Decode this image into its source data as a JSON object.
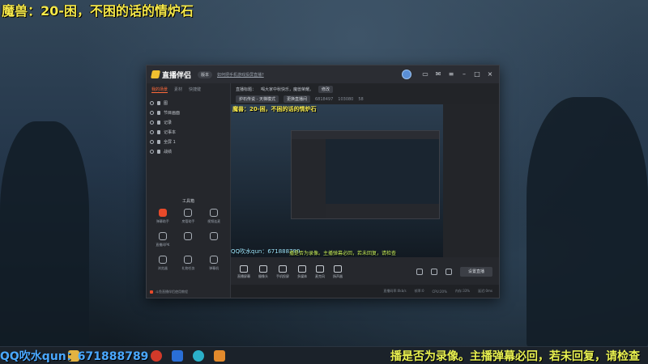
{
  "overlay": {
    "title": "魔兽：20-困，不困的话的情炉石",
    "qq_group": "QQ吹水qun：671888789",
    "ticker": "播是否为录像。主播弹幕必回，若未回复，请检查"
  },
  "app": {
    "name": "直播伴侣",
    "version_label": "版本",
    "promo_text": "如何把手机游戏投屏直播?",
    "sidebar": {
      "tabs": [
        "我的场景",
        "素材",
        "快捷键"
      ],
      "scenes": [
        "图",
        "节目画面",
        "记录",
        "记事本",
        "全屏 1",
        "战绩"
      ],
      "tools_title": "工具箱",
      "tools": [
        "弹幕助手",
        "房管助手",
        "视频连麦",
        "直播间PK",
        "",
        "",
        "浏览器",
        "礼物任务",
        "弹幕机"
      ],
      "footer": "斗鱼直播伴侣使用教程"
    },
    "header": {
      "live_title_label": "直播标题：",
      "live_title": "喝大家中秋快乐，魔兽荣耀。",
      "edit": "修改",
      "category": "炉石传说 - 天梯模式",
      "change_category": "更换直播间",
      "room_id": "6818497",
      "stat1": "103080",
      "stat2": "58"
    },
    "controls": [
      "直播屏幕",
      "摄像头",
      "手机投屏",
      "多媒体",
      "麦克风",
      "扬声器"
    ],
    "start_button": "设置直播",
    "status": [
      "直播码率:0kb/s",
      "帧率:0",
      "CPU:20%",
      "内存:33%",
      "延迟:0ms"
    ]
  }
}
